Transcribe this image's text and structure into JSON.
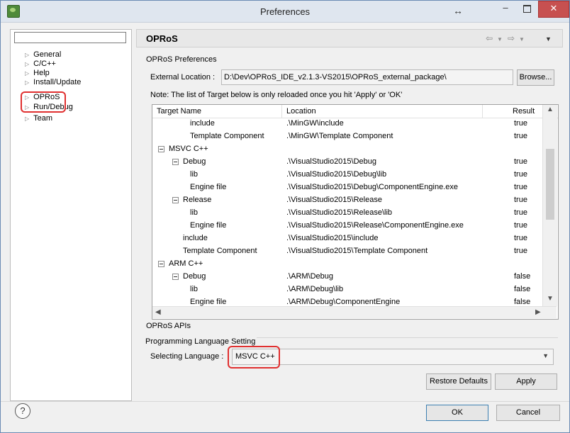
{
  "window": {
    "title": "Preferences",
    "resize_glyph": "↔",
    "minimize_glyph": "–",
    "close_glyph": "✕"
  },
  "sidebar": {
    "filter_value": "",
    "items": [
      {
        "label": "General"
      },
      {
        "label": "C/C++"
      },
      {
        "label": "Help"
      },
      {
        "label": "Install/Update"
      },
      {
        "label": "OPRoS",
        "selected": true
      },
      {
        "label": "Run/Debug"
      },
      {
        "label": "Team"
      }
    ]
  },
  "page": {
    "title": "OPRoS",
    "section_label": "OPRoS Preferences",
    "external_location_label": "External Location :",
    "external_location_value": "D:\\Dev\\OPRoS_IDE_v2.1.3-VS2015\\OPRoS_external_package\\",
    "browse_label": "Browse...",
    "note": "Note: The list of Target below is only reloaded once you hit 'Apply' or 'OK'"
  },
  "table": {
    "columns": [
      "Target Name",
      "Location",
      "Result"
    ],
    "rows": [
      {
        "name": "include",
        "indent": 2,
        "toggle": false,
        "location": ".\\MinGW\\include",
        "result": "true"
      },
      {
        "name": "Template Component",
        "indent": 2,
        "toggle": false,
        "location": ".\\MinGW\\Template Component",
        "result": "true"
      },
      {
        "name": "MSVC C++",
        "indent": 0,
        "toggle": true,
        "location": "",
        "result": ""
      },
      {
        "name": "Debug",
        "indent": 1,
        "toggle": true,
        "location": ".\\VisualStudio2015\\Debug",
        "result": "true"
      },
      {
        "name": "lib",
        "indent": 2,
        "toggle": false,
        "location": ".\\VisualStudio2015\\Debug\\lib",
        "result": "true"
      },
      {
        "name": "Engine file",
        "indent": 2,
        "toggle": false,
        "location": ".\\VisualStudio2015\\Debug\\ComponentEngine.exe",
        "result": "true"
      },
      {
        "name": "Release",
        "indent": 1,
        "toggle": true,
        "location": ".\\VisualStudio2015\\Release",
        "result": "true"
      },
      {
        "name": "lib",
        "indent": 2,
        "toggle": false,
        "location": ".\\VisualStudio2015\\Release\\lib",
        "result": "true"
      },
      {
        "name": "Engine file",
        "indent": 2,
        "toggle": false,
        "location": ".\\VisualStudio2015\\Release\\ComponentEngine.exe",
        "result": "true"
      },
      {
        "name": "include",
        "indent": 1,
        "toggle": false,
        "location": ".\\VisualStudio2015\\include",
        "result": "true"
      },
      {
        "name": "Template Component",
        "indent": 1,
        "toggle": false,
        "location": ".\\VisualStudio2015\\Template Component",
        "result": "true"
      },
      {
        "name": "ARM C++",
        "indent": 0,
        "toggle": true,
        "location": "",
        "result": ""
      },
      {
        "name": "Debug",
        "indent": 1,
        "toggle": true,
        "location": ".\\ARM\\Debug",
        "result": "false"
      },
      {
        "name": "lib",
        "indent": 2,
        "toggle": false,
        "location": ".\\ARM\\Debug\\lib",
        "result": "false"
      },
      {
        "name": "Engine file",
        "indent": 2,
        "toggle": false,
        "location": ".\\ARM\\Debug\\ComponentEngine",
        "result": "false"
      }
    ]
  },
  "apis": {
    "label": "OPRoS APIs",
    "group_title": "Programming Language Setting",
    "selecting_label": "Selecting Language :",
    "selected_language": "MSVC C++"
  },
  "buttons": {
    "restore_defaults": "Restore Defaults",
    "apply": "Apply",
    "ok": "OK",
    "cancel": "Cancel",
    "help_glyph": "?"
  },
  "colors": {
    "highlight_outline": "#e03030",
    "close_button": "#c75050"
  }
}
